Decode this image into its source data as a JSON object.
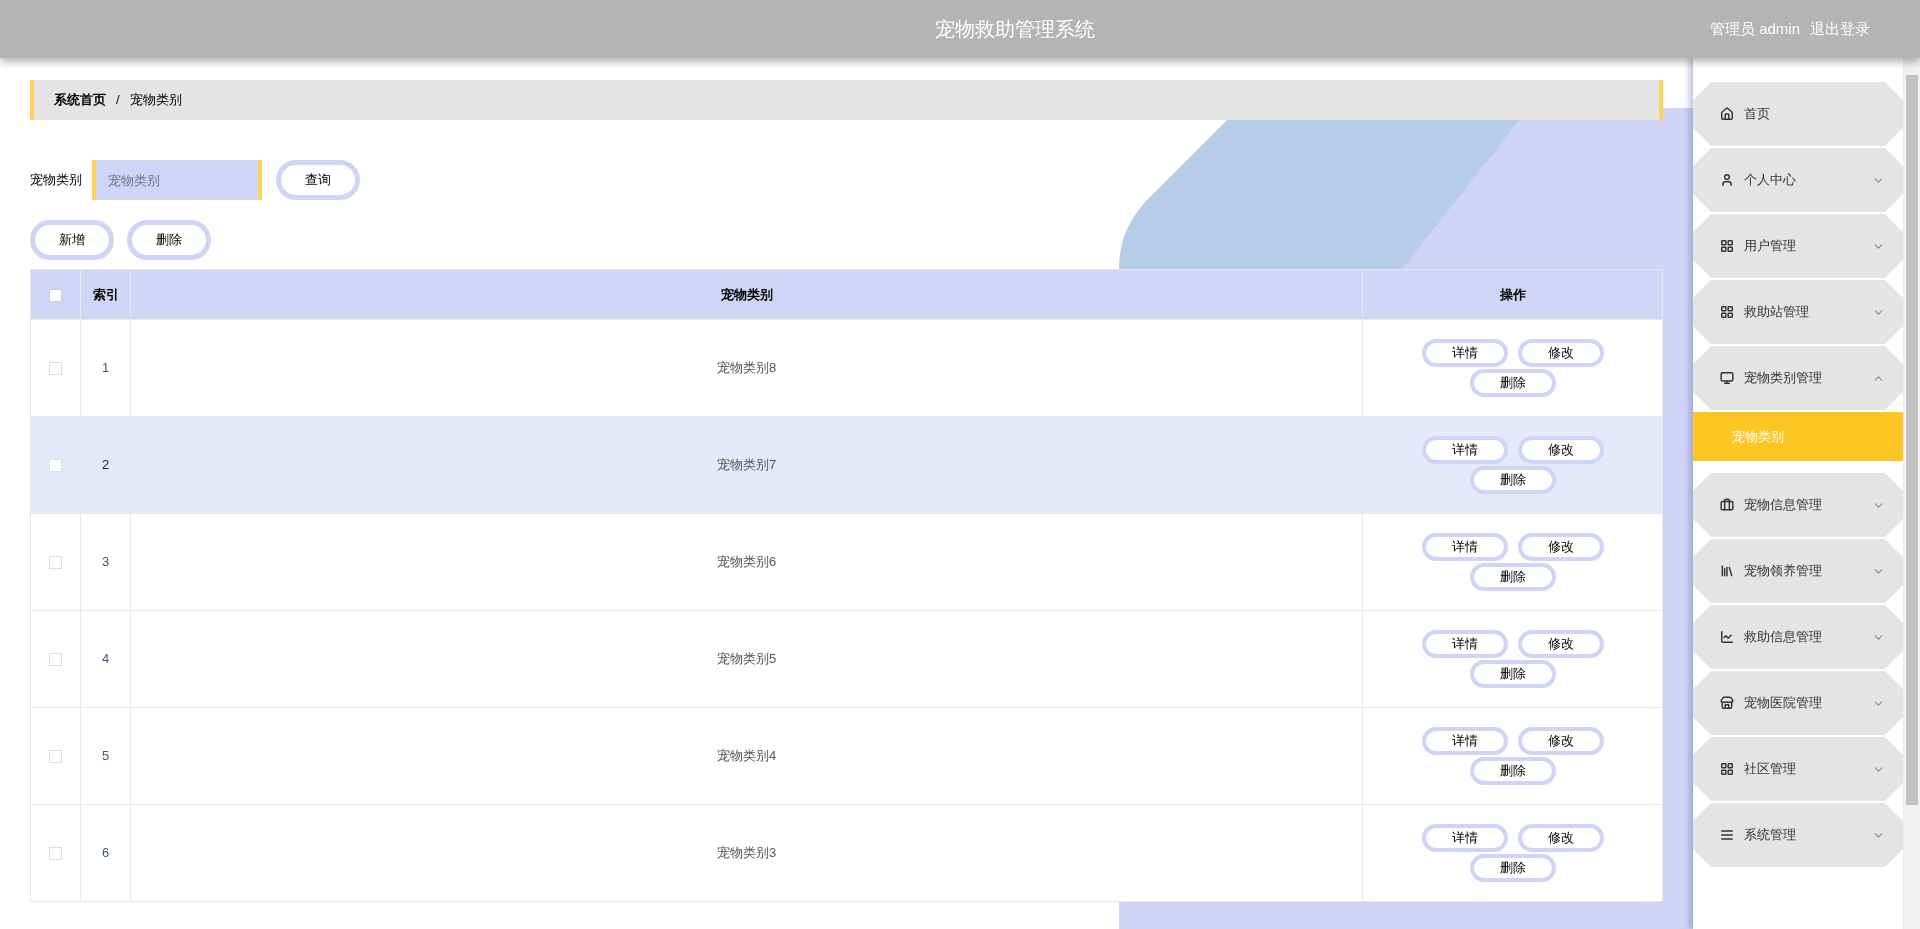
{
  "header": {
    "title": "宠物救助管理系统",
    "user": "管理员 admin",
    "logout": "退出登录"
  },
  "breadcrumb": [
    "系统首页",
    "/",
    "宠物类别"
  ],
  "search": {
    "label": "宠物类别",
    "placeholder": "宠物类别",
    "button": "查询"
  },
  "actions": [
    "新增",
    "删除"
  ],
  "table": {
    "columns": [
      "索引",
      "宠物类别",
      "操作"
    ],
    "header_checked": false,
    "rows": [
      {
        "index": "1",
        "name": "宠物类别8",
        "checked": false,
        "highlighted": false,
        "buttons": [
          "详情",
          "修改",
          "删除"
        ]
      },
      {
        "index": "2",
        "name": "宠物类别7",
        "checked": false,
        "highlighted": true,
        "buttons": [
          "详情",
          "修改",
          "删除"
        ]
      },
      {
        "index": "3",
        "name": "宠物类别6",
        "checked": false,
        "highlighted": false,
        "buttons": [
          "详情",
          "修改",
          "删除"
        ]
      },
      {
        "index": "4",
        "name": "宠物类别5",
        "checked": false,
        "highlighted": false,
        "buttons": [
          "详情",
          "修改",
          "删除"
        ]
      },
      {
        "index": "5",
        "name": "宠物类别4",
        "checked": false,
        "highlighted": false,
        "buttons": [
          "详情",
          "修改",
          "删除"
        ]
      },
      {
        "index": "6",
        "name": "宠物类别3",
        "checked": false,
        "highlighted": false,
        "buttons": [
          "详情",
          "修改",
          "删除"
        ]
      }
    ]
  },
  "sidebar": {
    "items": [
      {
        "label": "首页",
        "kind": "link"
      },
      {
        "label": "个人中心",
        "kind": "group",
        "expanded": false
      },
      {
        "label": "用户管理",
        "kind": "group",
        "expanded": false
      },
      {
        "label": "救助站管理",
        "kind": "group",
        "expanded": false
      },
      {
        "label": "宠物类别管理",
        "kind": "group",
        "expanded": true,
        "children": [
          {
            "label": "宠物类别",
            "selected": true
          }
        ]
      },
      {
        "label": "宠物信息管理",
        "kind": "group",
        "expanded": false
      },
      {
        "label": "宠物领养管理",
        "kind": "group",
        "expanded": false
      },
      {
        "label": "救助信息管理",
        "kind": "group",
        "expanded": false
      },
      {
        "label": "宠物医院管理",
        "kind": "group",
        "expanded": false
      },
      {
        "label": "社区管理",
        "kind": "group",
        "expanded": false
      },
      {
        "label": "系统管理",
        "kind": "group",
        "expanded": false
      }
    ]
  }
}
